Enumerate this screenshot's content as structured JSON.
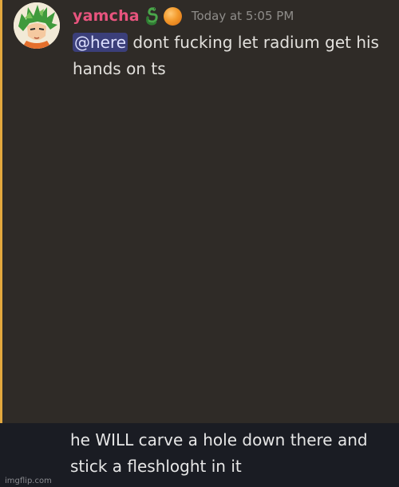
{
  "message": {
    "author": "yamcha",
    "timestamp": "Today at 5:05 PM",
    "mention": "@here",
    "text": " dont fucking let radium get his hands on ts",
    "role_icon": "green-serpent-icon",
    "badge_icon": "orange-orb-icon",
    "avatar_icon": "anime-character-avatar",
    "colors": {
      "username": "#e8547e",
      "accent_bar": "#e3a83e",
      "mention_bg": "#3b3f7a",
      "panel_bg": "#2f2b27"
    }
  },
  "caption": {
    "text": "he WILL carve a hole down there and stick a fleshloght in it"
  },
  "watermark": "imgflip.com"
}
